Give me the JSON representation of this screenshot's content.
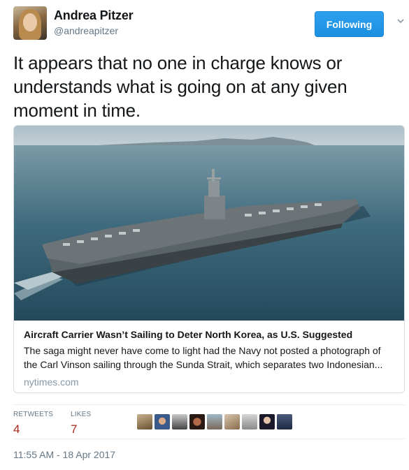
{
  "user": {
    "display_name": "Andrea Pitzer",
    "handle": "@andreapitzer"
  },
  "follow_button": {
    "label": "Following"
  },
  "tweet": {
    "text_lines": [
      "It appears that no one in charge knows or",
      "understands what is going on at any given",
      "moment in time."
    ]
  },
  "card": {
    "title": "Aircraft Carrier Wasn’t Sailing to Deter North Korea, as U.S. Suggested",
    "description_lines": [
      "The saga might never have come to light had the Navy not posted a photograph of",
      "the Carl Vinson sailing through the Sunda Strait, which separates two Indonesian..."
    ],
    "domain": "nytimes.com"
  },
  "stats": {
    "retweets_label": "RETWEETS",
    "retweets_count": "4",
    "likes_label": "LIKES",
    "likes_count": "7"
  },
  "liker_avatars": [
    "avatar-1",
    "avatar-2",
    "avatar-3",
    "avatar-4",
    "avatar-5",
    "avatar-6",
    "avatar-7",
    "avatar-8",
    "avatar-9"
  ],
  "timestamp": "11:55 AM - 18 Apr 2017",
  "colors": {
    "follow_button": "#1da1f2",
    "count": "#a4281c",
    "muted": "#657786"
  }
}
